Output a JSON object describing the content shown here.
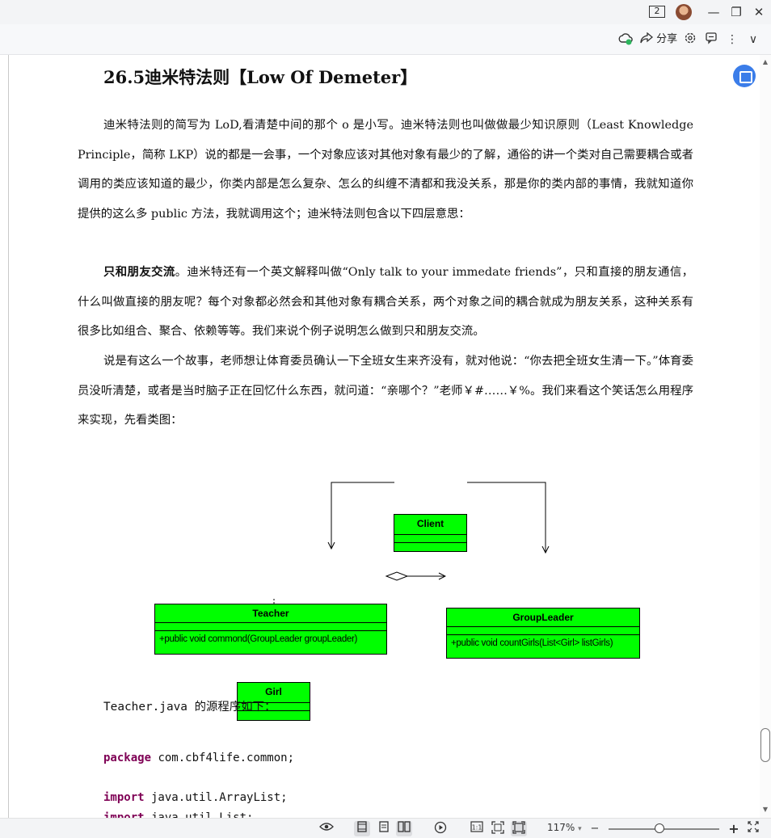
{
  "titlebar": {
    "window_count": "2",
    "minimize": "—",
    "restore": "❐",
    "close": "✕"
  },
  "toolbar": {
    "share_label": "分享",
    "more": "⋮",
    "collapse": "∨"
  },
  "document": {
    "heading": "26.5迪米特法则【Low Of Demeter】",
    "para1": "迪米特法则的简写为 LoD,看清楚中间的那个 o 是小写。迪米特法则也叫做做最少知识原则（Least Knowledge Principle，简称 LKP）说的都是一会事，一个对象应该对其他对象有最少的了解，通俗的讲一个类对自己需要耦合或者调用的类应该知道的最少，你类内部是怎么复杂、怎么的纠缠不清都和我没关系，那是你的类内部的事情，我就知道你提供的这么多 public 方法，我就调用这个；迪米特法则包含以下四层意思：",
    "para2_bold": "只和朋友交流",
    "para2_rest": "。迪米特还有一个英文解释叫做“Only talk to your immedate friends”，只和直接的朋友通信，什么叫做直接的朋友呢？每个对象都必然会和其他对象有耦合关系，两个对象之间的耦合就成为朋友关系，这种关系有很多比如组合、聚合、依赖等等。我们来说个例子说明怎么做到只和朋友交流。",
    "para3": "说是有这么一个故事，老师想让体育委员确认一下全班女生来齐没有，就对他说：“你去把全班女生清一下。”体育委员没听清楚，或者是当时脑子正在回忆什么东西，就问道：“亲哪个？”老师￥#……￥%。我们来看这个笑话怎么用程序来实现，先看类图：",
    "code_intro": "Teacher.java 的源程序如下：",
    "code_line1_kw": "package",
    "code_line1_rest": " com.cbf4life.common;",
    "code_line2_kw": "import",
    "code_line2_rest": " java.util.ArrayList;",
    "code_line3_kw": "import",
    "code_line3_rest": " java.util.List;"
  },
  "uml": {
    "client": "Client",
    "teacher": "Teacher",
    "teacher_op": "+public void commond(GroupLeader groupLeader)",
    "groupleader": "GroupLeader",
    "groupleader_op": "+public void countGirls(List<Girl> listGirls)",
    "girl": "Girl",
    "box_color": "#00ff00"
  },
  "statusbar": {
    "zoom": "117%",
    "zoom_caret": "▾",
    "zoom_out": "−",
    "zoom_in": "+",
    "zoom_level": 0.46
  },
  "icons": [
    "eye-icon",
    "single-page-icon",
    "continuous-page-icon",
    "two-page-icon",
    "play-icon",
    "actual-size-icon",
    "fit-width-icon",
    "fit-page-icon",
    "fullscreen-icon"
  ]
}
